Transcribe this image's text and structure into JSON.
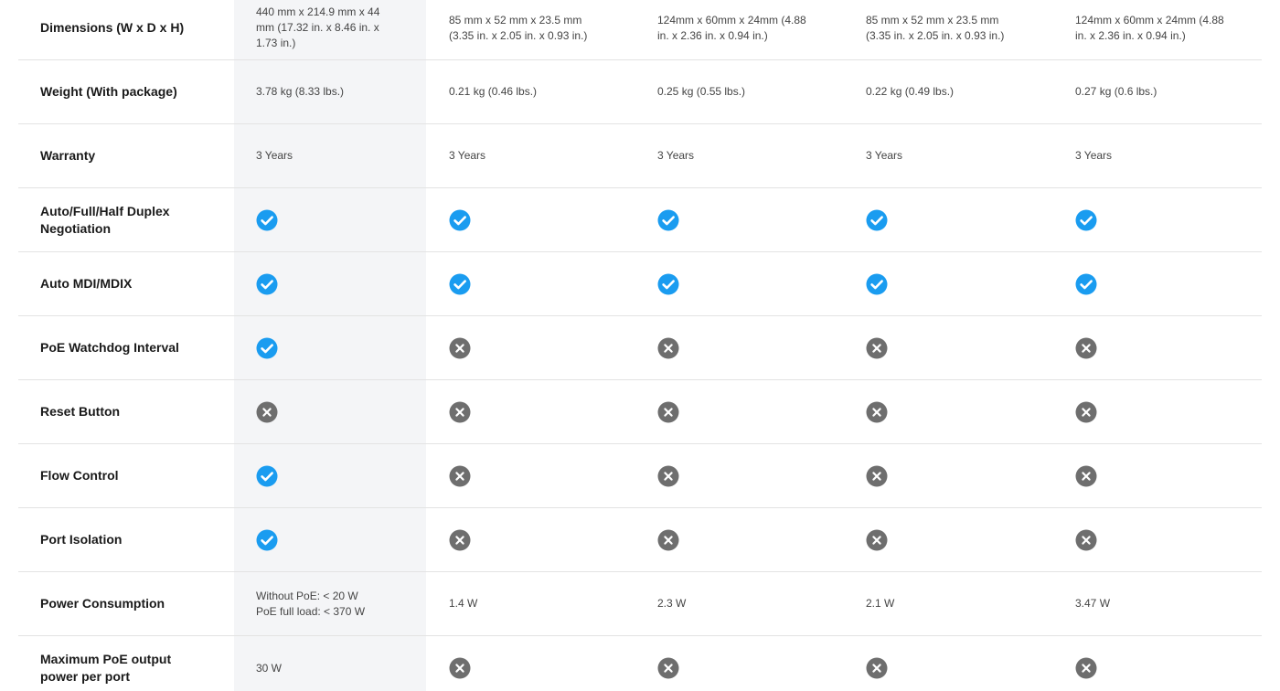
{
  "colors": {
    "check": "#1a9cf0",
    "cross": "#6e6e6e",
    "highlight_column": "#f4f5f7",
    "divider": "#e3e3e3"
  },
  "rows": [
    {
      "label": "Dimensions (W x D x H)",
      "cells": [
        {
          "type": "text",
          "text": "440 mm x 214.9 mm x 44\nmm (17.32 in. x 8.46 in. x\n1.73 in.)"
        },
        {
          "type": "text",
          "text": "85 mm x 52 mm x 23.5 mm\n(3.35 in. x 2.05 in. x 0.93 in.)"
        },
        {
          "type": "text",
          "text": "124mm x 60mm x 24mm (4.88\nin. x 2.36 in. x 0.94 in.)"
        },
        {
          "type": "text",
          "text": "85 mm x 52 mm x 23.5 mm\n(3.35 in. x 2.05 in. x 0.93 in.)"
        },
        {
          "type": "text",
          "text": "124mm x 60mm x 24mm (4.88\nin. x 2.36 in. x 0.94 in.)"
        }
      ]
    },
    {
      "label": "Weight (With package)",
      "cells": [
        {
          "type": "text",
          "text": "3.78 kg (8.33 lbs.)"
        },
        {
          "type": "text",
          "text": "0.21 kg (0.46 lbs.)"
        },
        {
          "type": "text",
          "text": "0.25 kg (0.55 lbs.)"
        },
        {
          "type": "text",
          "text": "0.22 kg (0.49 lbs.)"
        },
        {
          "type": "text",
          "text": "0.27 kg (0.6 lbs.)"
        }
      ]
    },
    {
      "label": "Warranty",
      "cells": [
        {
          "type": "text",
          "text": "3 Years"
        },
        {
          "type": "text",
          "text": "3 Years"
        },
        {
          "type": "text",
          "text": "3 Years"
        },
        {
          "type": "text",
          "text": "3 Years"
        },
        {
          "type": "text",
          "text": "3 Years"
        }
      ]
    },
    {
      "label": "Auto/Full/Half Duplex\nNegotiation",
      "cells": [
        {
          "type": "icon",
          "icon": "check-icon"
        },
        {
          "type": "icon",
          "icon": "check-icon"
        },
        {
          "type": "icon",
          "icon": "check-icon"
        },
        {
          "type": "icon",
          "icon": "check-icon"
        },
        {
          "type": "icon",
          "icon": "check-icon"
        }
      ]
    },
    {
      "label": "Auto MDI/MDIX",
      "cells": [
        {
          "type": "icon",
          "icon": "check-icon"
        },
        {
          "type": "icon",
          "icon": "check-icon"
        },
        {
          "type": "icon",
          "icon": "check-icon"
        },
        {
          "type": "icon",
          "icon": "check-icon"
        },
        {
          "type": "icon",
          "icon": "check-icon"
        }
      ]
    },
    {
      "label": "PoE Watchdog Interval",
      "cells": [
        {
          "type": "icon",
          "icon": "check-icon"
        },
        {
          "type": "icon",
          "icon": "cross-icon"
        },
        {
          "type": "icon",
          "icon": "cross-icon"
        },
        {
          "type": "icon",
          "icon": "cross-icon"
        },
        {
          "type": "icon",
          "icon": "cross-icon"
        }
      ]
    },
    {
      "label": "Reset Button",
      "cells": [
        {
          "type": "icon",
          "icon": "cross-icon"
        },
        {
          "type": "icon",
          "icon": "cross-icon"
        },
        {
          "type": "icon",
          "icon": "cross-icon"
        },
        {
          "type": "icon",
          "icon": "cross-icon"
        },
        {
          "type": "icon",
          "icon": "cross-icon"
        }
      ]
    },
    {
      "label": "Flow Control",
      "cells": [
        {
          "type": "icon",
          "icon": "check-icon"
        },
        {
          "type": "icon",
          "icon": "cross-icon"
        },
        {
          "type": "icon",
          "icon": "cross-icon"
        },
        {
          "type": "icon",
          "icon": "cross-icon"
        },
        {
          "type": "icon",
          "icon": "cross-icon"
        }
      ]
    },
    {
      "label": "Port Isolation",
      "cells": [
        {
          "type": "icon",
          "icon": "check-icon"
        },
        {
          "type": "icon",
          "icon": "cross-icon"
        },
        {
          "type": "icon",
          "icon": "cross-icon"
        },
        {
          "type": "icon",
          "icon": "cross-icon"
        },
        {
          "type": "icon",
          "icon": "cross-icon"
        }
      ]
    },
    {
      "label": "Power Consumption",
      "cells": [
        {
          "type": "text",
          "text": "Without PoE: < 20 W\nPoE full load: < 370 W"
        },
        {
          "type": "text",
          "text": "1.4 W"
        },
        {
          "type": "text",
          "text": "2.3 W"
        },
        {
          "type": "text",
          "text": "2.1 W"
        },
        {
          "type": "text",
          "text": "3.47 W"
        }
      ]
    },
    {
      "label": "Maximum PoE output\npower per port",
      "cells": [
        {
          "type": "text",
          "text": "30 W"
        },
        {
          "type": "icon",
          "icon": "cross-icon"
        },
        {
          "type": "icon",
          "icon": "cross-icon"
        },
        {
          "type": "icon",
          "icon": "cross-icon"
        },
        {
          "type": "icon",
          "icon": "cross-icon"
        }
      ]
    }
  ]
}
